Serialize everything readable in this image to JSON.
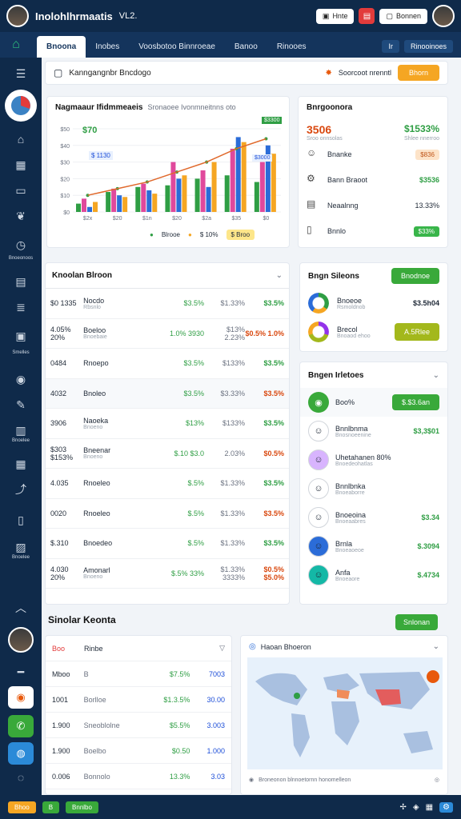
{
  "app": {
    "title": "Inolohlhrmaatis",
    "version": "VL2."
  },
  "topbar": {
    "btn1": "Hnte",
    "btn2": "Bonnen"
  },
  "nav": {
    "tabs": [
      "Bnoona",
      "Inobes",
      "Voosbotoo Binnroeae",
      "Banoo",
      "Rinooes"
    ],
    "right1": "Ir",
    "right2": "Rinooinoes"
  },
  "sidebar": {
    "labels": [
      "Bnoeonoos",
      "Smelles",
      "Bnoelee",
      "Bnoelee"
    ]
  },
  "search": {
    "text": "Kanngangnbr Bncdogo",
    "right_text": "Soorcoot nrenntl",
    "button": "Bhorn"
  },
  "chart_card": {
    "title": "Nagmaaur Ifidmmeaeis",
    "subtitle": "Sronaoee Ivonmneitnns oto",
    "value_label": "$70",
    "annotation1": "$ 1130",
    "annotation2": "$3300",
    "annotation3": "$3000",
    "legend1": "Blrooe",
    "legend2": "$ 10%",
    "legend_btn": "$ Broo",
    "y_ticks": [
      "$50",
      "$40",
      "$30",
      "$20",
      "$10",
      "$0"
    ],
    "x_ticks": [
      "$2x",
      "$20",
      "$1n",
      "$20",
      "$2a",
      "$35",
      "$0"
    ]
  },
  "chart_data": {
    "type": "bar",
    "categories": [
      "$2x",
      "$20",
      "$1n",
      "$20",
      "$2a",
      "$35",
      "$0"
    ],
    "series": [
      {
        "name": "Blrooe",
        "values": [
          5,
          12,
          15,
          16,
          20,
          22,
          18
        ]
      },
      {
        "name": "",
        "values": [
          8,
          14,
          17,
          30,
          25,
          38,
          30
        ]
      },
      {
        "name": "",
        "values": [
          3,
          10,
          13,
          20,
          15,
          45,
          40
        ]
      },
      {
        "name": "",
        "values": [
          6,
          9,
          11,
          22,
          30,
          42,
          35
        ]
      }
    ],
    "line": [
      10,
      14,
      18,
      24,
      30,
      38,
      44
    ],
    "ylim": [
      0,
      50
    ]
  },
  "metrics": {
    "title": "Bnrgoonora",
    "big_value": "3506",
    "big_sub": "Sroo onnsolas",
    "big_pct": "$1533%",
    "big_pct_sub": "Shlee nnerroo",
    "rows": [
      {
        "label": "Bnanke",
        "value": "$836"
      },
      {
        "label": "Bann Braoot",
        "value": "$3536"
      },
      {
        "label": "Neaalnng",
        "value": "13.33%"
      },
      {
        "label": "Bnnlo",
        "value": "$33%"
      }
    ]
  },
  "table": {
    "title": "Knoolan Blroon",
    "rows": [
      {
        "c1": "$0 1335",
        "c2": "Nocdo",
        "c2s": "Rbsnlo",
        "c3": "$3.5%",
        "c4": "$1.33%",
        "c5": "$3.5%"
      },
      {
        "c1": "4.05% 20%",
        "c2": "Boeloo",
        "c2s": "Bnoebaie",
        "c3": "1.0% 3930",
        "c4": "$13% 2.23%",
        "c5": "$0.5% 1.0%"
      },
      {
        "c1": "0484",
        "c2": "Rnoepo",
        "c2s": "",
        "c3": "$3.5%",
        "c4": "$133%",
        "c5": "$3.5%"
      },
      {
        "c1": "4032",
        "c2": "Bnoleo",
        "c2s": "",
        "c3": "$3.5%",
        "c4": "$3.33%",
        "c5": "$3.5%"
      },
      {
        "c1": "3906",
        "c2": "Naoeka",
        "c2s": "Bnoeno",
        "c3": "$13%",
        "c4": "$133%",
        "c5": "$3.5%"
      },
      {
        "c1": "$303 $153%",
        "c2": "Bneenar",
        "c2s": "Bnoeno",
        "c3": "$.10 $3.0",
        "c4": "2.03%",
        "c5": "$0.5%"
      },
      {
        "c1": "4.035",
        "c2": "Rnoeleo",
        "c2s": "",
        "c3": "$.5%",
        "c4": "$1.33%",
        "c5": "$3.5%"
      },
      {
        "c1": "0020",
        "c2": "Rnoeleo",
        "c2s": "",
        "c3": "$.5%",
        "c4": "$1.33%",
        "c5": "$3.5%"
      },
      {
        "c1": "$.310",
        "c2": "Bnoedeo",
        "c2s": "",
        "c3": "$.5%",
        "c4": "$1.33%",
        "c5": "$3.5%"
      },
      {
        "c1": "4.030 20%",
        "c2": "Amonarl",
        "c2s": "Bnoeno",
        "c3": "$.5% 33%",
        "c4": "$1.33% 3333%",
        "c5": "$0.5% $5.0%"
      }
    ]
  },
  "right1": {
    "title": "Bngn Sileons",
    "button": "Bnodnoe",
    "rows": [
      {
        "label": "Bnoeoe",
        "sub": "Rsmoldnob",
        "value": "$3.5h04"
      },
      {
        "label": "Brecol",
        "sub": "Bnoaod ehoo",
        "value": "A.5Rlee"
      }
    ]
  },
  "right2": {
    "title": "Bngen Irletoes",
    "top_label": "Boo%",
    "top_button": "$.$3.6an",
    "rows": [
      {
        "label": "Bnnlbnma",
        "sub": "Bnosnoeenine",
        "value": "$3,3$01"
      },
      {
        "label": "Uhetahanen 80%",
        "sub": "Bnoedeohatlas",
        "value": ""
      },
      {
        "label": "Bnnlbnka",
        "sub": "Bnoeaborre",
        "value": ""
      },
      {
        "label": "Bnoeoina",
        "sub": "Bnoeaabres",
        "value": "$3.34"
      },
      {
        "label": "Brnla",
        "sub": "Bnoeaoeoe",
        "value": "$.3094"
      },
      {
        "label": "Anfa",
        "sub": "Bnoeaore",
        "value": "$.4734"
      }
    ]
  },
  "section": {
    "title": "Sinolar Keonta",
    "button": "Snlonan"
  },
  "bottom_table": {
    "header": [
      "Boo",
      "Rinbe"
    ],
    "rows": [
      {
        "c1": "Mboo",
        "c2": "B",
        "c3": "$7.5%",
        "c4": "7003"
      },
      {
        "c1": "1001",
        "c2": "Borlloe",
        "c3": "$1.3.5%",
        "c4": "30.00"
      },
      {
        "c1": "1.900",
        "c2": "Sneoblolne",
        "c3": "$5.5%",
        "c4": "3.003"
      },
      {
        "c1": "1.900",
        "c2": "Boelbo",
        "c3": "$0.50",
        "c4": "1.000"
      },
      {
        "c1": "0.006",
        "c2": "Bonnolo",
        "c3": "13.3%",
        "c4": "3.03"
      }
    ]
  },
  "map": {
    "title": "Haoan Bhoeron",
    "footer": "Broneonon blnnoetornn honomelleon"
  },
  "footer": {
    "btn1": "Bhoo",
    "btn2": "B",
    "btn3": "Bnnlbo"
  },
  "colors": {
    "navy": "#0f2a4a",
    "green": "#39a93a",
    "orange": "#f5a623"
  }
}
